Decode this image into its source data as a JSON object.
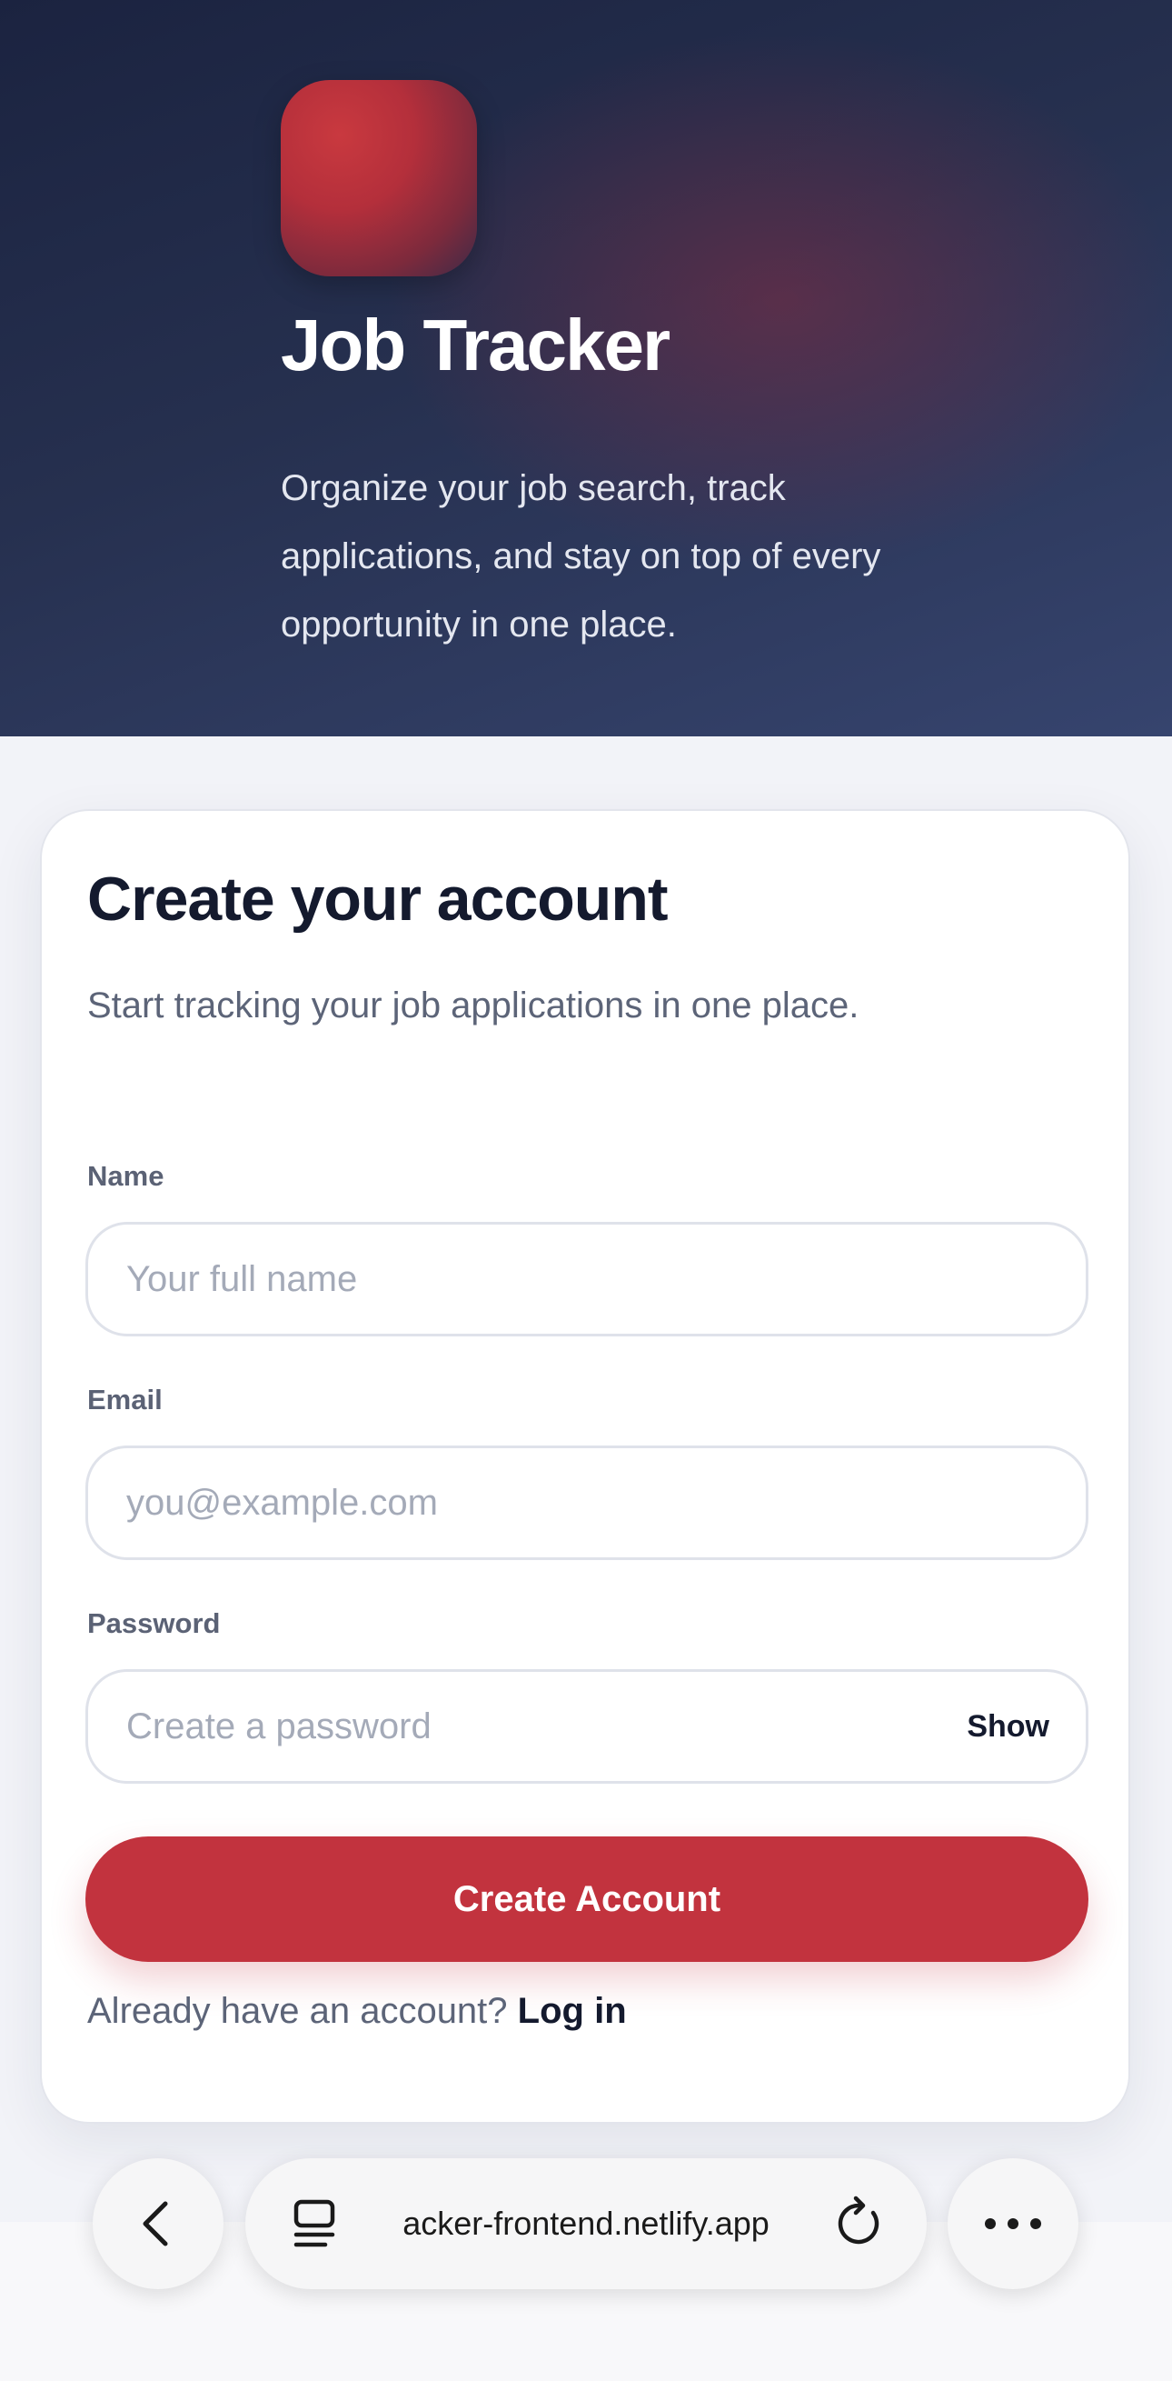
{
  "hero": {
    "title": "Job Tracker",
    "tagline": "Organize your job search, track applications, and stay on top of every opportunity in one place."
  },
  "signup": {
    "title": "Create your account",
    "subtitle": "Start tracking your job applications in one place.",
    "name_label": "Name",
    "name_placeholder": "Your full name",
    "email_label": "Email",
    "email_placeholder": "you@example.com",
    "password_label": "Password",
    "password_placeholder": "Create a password",
    "show_label": "Show",
    "submit_label": "Create Account",
    "login_prompt": "Already have an account?",
    "login_link": "Log in"
  },
  "browser": {
    "url": "acker-frontend.netlify.app",
    "icons": [
      "back-icon",
      "tabs-icon",
      "reload-icon",
      "more-icon"
    ]
  },
  "colors": {
    "accent": "#c2333e",
    "hero_bg": "#26304f",
    "text_dark": "#141a2e"
  }
}
